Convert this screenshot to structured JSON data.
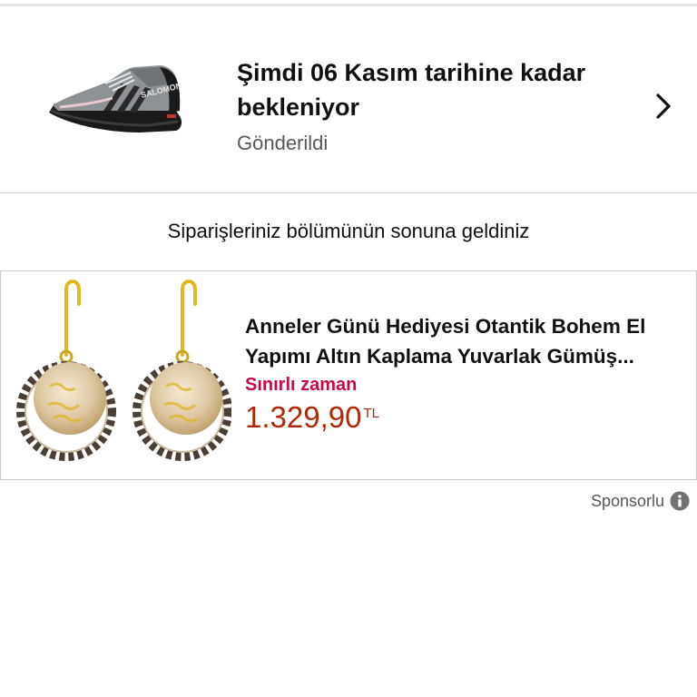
{
  "order": {
    "title": "Şimdi 06 Kasım tarihine kadar bekleniyor",
    "status": "Gönderildi",
    "image_icon": "running-shoe-image",
    "chevron_icon": "chevron-right-icon"
  },
  "end_message": "Siparişleriniz bölümünün sonuna geldiniz",
  "ad": {
    "title": "Anneler Günü Hediyesi Otantik Bohem El Yapımı Altın Kaplama Yuvarlak Gümüş...",
    "badge": "Sınırlı zaman",
    "price": "1.329,90",
    "currency": "TL",
    "image_icon": "earrings-image"
  },
  "sponsored": {
    "label": "Sponsorlu",
    "icon": "info-icon"
  },
  "colors": {
    "text_primary": "#0f1111",
    "text_secondary": "#565959",
    "deal": "#c7094c",
    "price": "#b12704",
    "divider": "#d5d9d9"
  }
}
